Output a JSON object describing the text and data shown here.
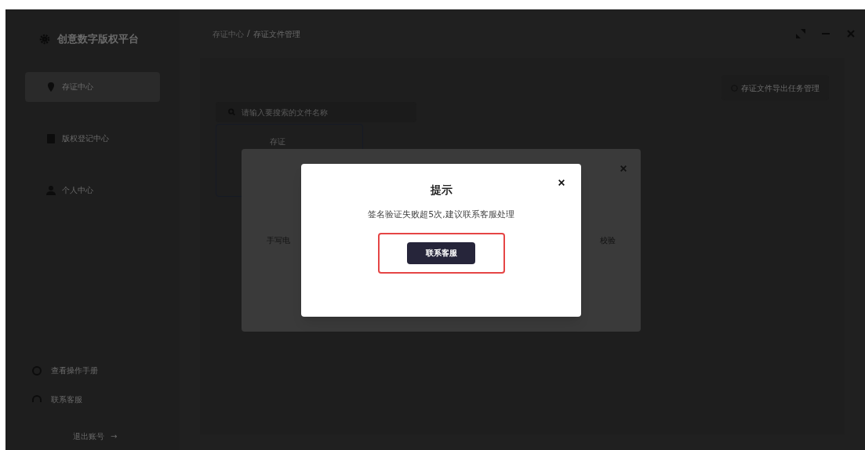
{
  "app": {
    "logo_text": "创意数字版权平台"
  },
  "sidebar": {
    "items": [
      {
        "label": "存证中心",
        "selected": true
      },
      {
        "label": "版权登记中心",
        "selected": false
      },
      {
        "label": "个人中心",
        "selected": false
      }
    ],
    "footer_items": [
      {
        "label": "查看操作手册"
      },
      {
        "label": "联系客服"
      }
    ],
    "logout": {
      "label": "退出账号",
      "arrow": "→"
    }
  },
  "breadcrumb": [
    "存证中心",
    "存证文件管理"
  ],
  "breadcrumb_separator": "/",
  "export_button": {
    "label": "存证文件导出任务管理"
  },
  "search": {
    "placeholder": "请输入要搜索的文件名称"
  },
  "card": {
    "title": "存证"
  },
  "back_dialog": {
    "left_text": "手写电",
    "right_text": "校验"
  },
  "dialog": {
    "title": "提示",
    "message": "签名验证失败超5次,建议联系客服处理",
    "button": "联系客服",
    "highlighted": true
  }
}
